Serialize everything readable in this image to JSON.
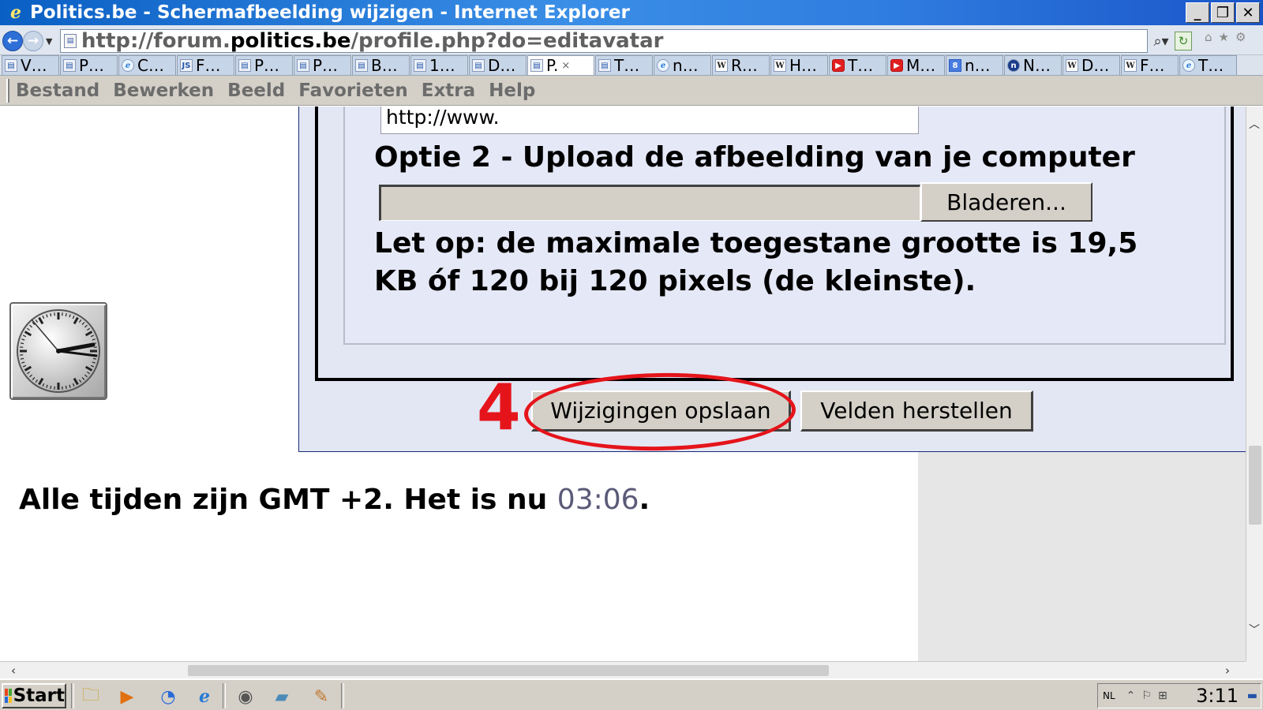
{
  "window": {
    "title": "Politics.be - Schermafbeelding wijzigen - Internet Explorer",
    "controls": [
      "_",
      "❐",
      "✕"
    ]
  },
  "address": {
    "url_prefix": "http://forum.",
    "url_domain": "politics.be",
    "url_path": "/profile.php?do=editavatar"
  },
  "tabs": [
    {
      "label": "V…",
      "icon": "page-icon",
      "type": "page"
    },
    {
      "label": "P…",
      "icon": "page-icon",
      "type": "page"
    },
    {
      "label": "C…",
      "icon": "ie-icon",
      "type": "ie"
    },
    {
      "label": "F…",
      "icon": "js-icon",
      "type": "js"
    },
    {
      "label": "P…",
      "icon": "page-icon",
      "type": "page"
    },
    {
      "label": "P…",
      "icon": "page-icon",
      "type": "page"
    },
    {
      "label": "B…",
      "icon": "page-icon",
      "type": "page"
    },
    {
      "label": "1…",
      "icon": "page-icon",
      "type": "page"
    },
    {
      "label": "D…",
      "icon": "page-icon",
      "type": "page"
    },
    {
      "label": "P.",
      "icon": "page-icon",
      "type": "page",
      "active": true
    },
    {
      "label": "T…",
      "icon": "page-icon",
      "type": "page"
    },
    {
      "label": "n…",
      "icon": "ie-icon",
      "type": "ie"
    },
    {
      "label": "R…",
      "icon": "wikipedia-icon",
      "type": "wiki"
    },
    {
      "label": "H…",
      "icon": "wikipedia-icon",
      "type": "wiki"
    },
    {
      "label": "T…",
      "icon": "youtube-icon",
      "type": "yt"
    },
    {
      "label": "M…",
      "icon": "youtube-icon",
      "type": "yt"
    },
    {
      "label": "n…",
      "icon": "g8-icon",
      "type": "g8"
    },
    {
      "label": "N…",
      "icon": "n-icon",
      "type": "n"
    },
    {
      "label": "D…",
      "icon": "wikipedia-icon",
      "type": "wiki"
    },
    {
      "label": "F…",
      "icon": "wikipedia-icon",
      "type": "wiki"
    },
    {
      "label": "T…",
      "icon": "ie-icon",
      "type": "ie"
    }
  ],
  "menu": [
    "Bestand",
    "Bewerken",
    "Beeld",
    "Favorieten",
    "Extra",
    "Help"
  ],
  "form": {
    "url_input_value": "http://www.",
    "option2_heading": "Optie 2 - Upload de afbeelding van je computer",
    "browse_label": "Bladeren...",
    "notice": "Let op: de maximale toegestane grootte is 19,5 KB óf 120 bij 120 pixels (de kleinste).",
    "step_number": "4",
    "save_label": "Wijzigingen opslaan",
    "reset_label": "Velden herstellen"
  },
  "footer": {
    "time_prefix": "Alle tijden zijn GMT +2. Het is nu ",
    "time_now": "03:06",
    "time_suffix": "."
  },
  "taskbar": {
    "start_label": "Start",
    "language": "NL",
    "clock": "3:11"
  },
  "colors": {
    "annotation_red": "#e5141b",
    "form_background": "#e3e6f3",
    "titlebar_blue": "#1a55c8"
  }
}
